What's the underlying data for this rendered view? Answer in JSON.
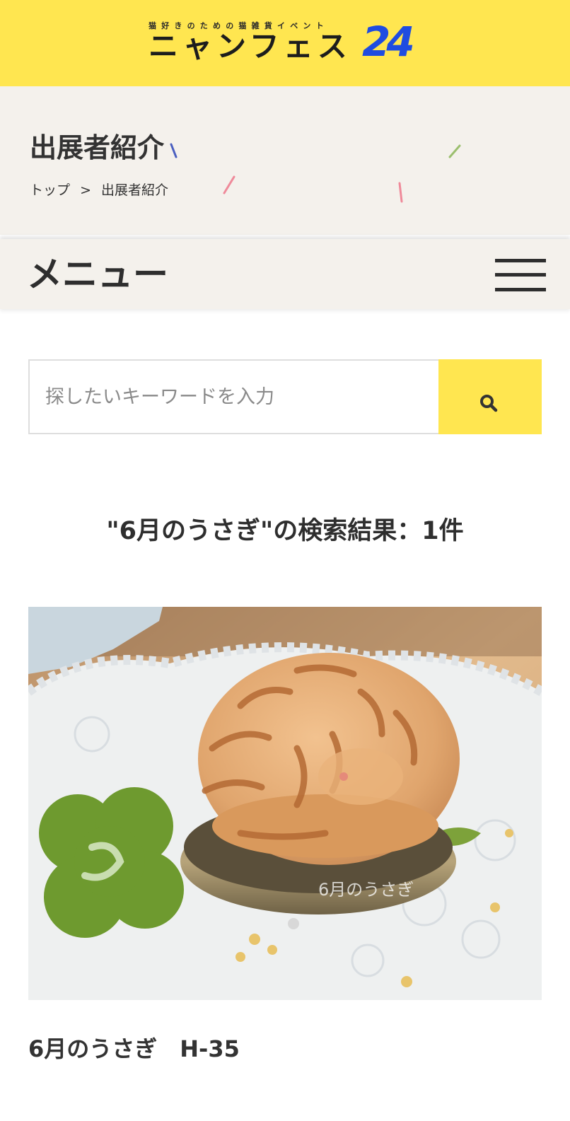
{
  "header": {
    "logo_tagline": "猫好きのための猫雑貨イベント",
    "logo_name": "ニャンフェス",
    "logo_number": "24"
  },
  "page_heading": {
    "title": "出展者紹介",
    "breadcrumb": {
      "home": "トップ",
      "separator": ">",
      "current": "出展者紹介"
    }
  },
  "menu": {
    "label": "メニュー",
    "toggle_icon": "hamburger-icon"
  },
  "search": {
    "placeholder": "探したいキーワードを入力",
    "value": "",
    "button_icon": "search-icon"
  },
  "results": {
    "heading": "\"6月のうさぎ\"の検索結果：1件",
    "items": [
      {
        "title": "6月のうさぎ　H-35",
        "image_watermark": "6月のうさぎ"
      }
    ]
  },
  "colors": {
    "accent_yellow": "#ffe650",
    "heading_bg": "#f4f1ec",
    "text": "#333333",
    "logo_number": "#1f4ce0"
  }
}
